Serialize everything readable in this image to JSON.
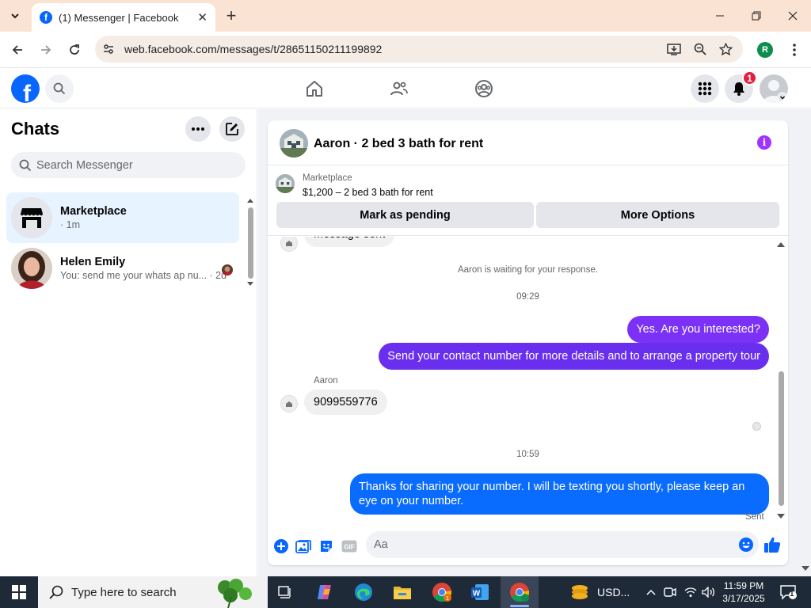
{
  "browser": {
    "tab_title": "(1) Messenger | Facebook",
    "url": "web.facebook.com/messages/t/28651150211199892",
    "profile_initial": "R"
  },
  "fb_header": {
    "notification_count": "1"
  },
  "sidebar": {
    "title": "Chats",
    "search_placeholder": "Search Messenger",
    "conversations": [
      {
        "name": "Marketplace",
        "subtitle": "· 1m",
        "active": true
      },
      {
        "name": "Helen Emily",
        "subtitle": "You: send me your whats ap nu... · 2d",
        "active": false
      }
    ]
  },
  "chat": {
    "title": "Aaron · 2 bed 3 bath for rent",
    "marketplace_label": "Marketplace",
    "listing": "$1,200 – 2 bed 3 bath for rent",
    "mark_pending_label": "Mark as pending",
    "more_options_label": "More Options",
    "messages": {
      "partial_top": "Message sent",
      "waiting_text": "Aaron is waiting for your response.",
      "time_1": "09:29",
      "out_1": "Yes. Are you interested?",
      "out_2": "Send your contact number for more details and to arrange a property tour",
      "sender_name": "Aaron",
      "in_1": "9099559776",
      "time_2": "10:59",
      "out_3": "Thanks for sharing your number. I will be texting you shortly, please keep an eye on your number.",
      "sent_status": "Sent"
    },
    "composer_placeholder": "Aa",
    "colors": {
      "purple_bubble": "#7b32f6",
      "purple_bubble_2": "#6a2fee",
      "blue_bubble": "#0a6cff",
      "accent": "#a033ff",
      "like": "#0866ff"
    }
  },
  "taskbar": {
    "search_placeholder": "Type here to search",
    "currency_widget": "USD...",
    "time": "11:59 PM",
    "date": "3/17/2025",
    "notif_count": "1"
  }
}
